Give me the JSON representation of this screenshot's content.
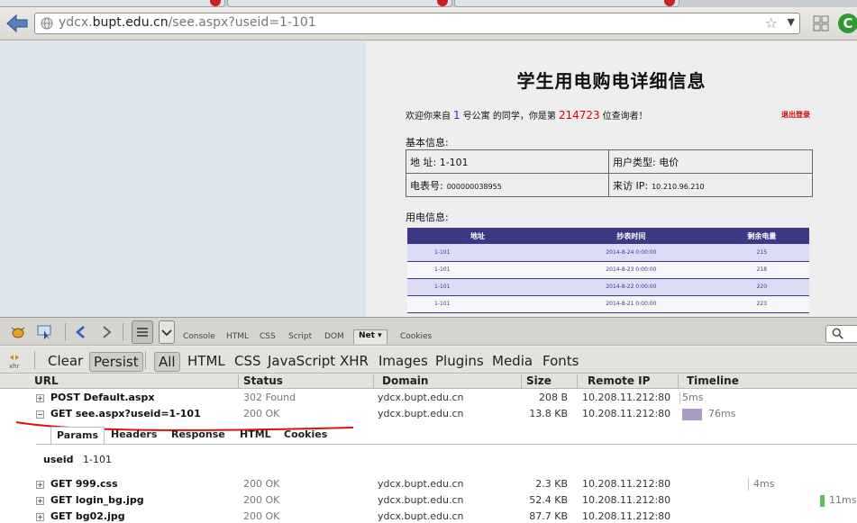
{
  "browser": {
    "url_prefix": "ydcx.",
    "url_host": "bupt.edu.cn",
    "url_path": "/see.aspx?useid=1-101"
  },
  "page": {
    "title": "学生用电购电详细信息",
    "welcome_a": "欢迎你来自",
    "dorm_no": "1",
    "welcome_b": "号公寓",
    "welcome_c": "的同学，你是第",
    "visitor_count": "214723",
    "welcome_d": "位查询者！",
    "logout": "退出登录",
    "basic_label": "基本信息:",
    "info": {
      "address_label": "地 址:",
      "address": "1-101",
      "user_type_label": "用户类型:",
      "user_type": "电价",
      "meter_label": "电表号:",
      "meter": "000000038955",
      "ip_label": "来访 IP:",
      "ip": "10.210.96.210"
    },
    "usage_label": "用电信息:",
    "usage_table": {
      "headers": [
        "地址",
        "抄表时间",
        "剩余电量"
      ],
      "rows": [
        [
          "1-101",
          "2014-8-24 0:00:00",
          "215"
        ],
        [
          "1-101",
          "2014-8-23 0:00:00",
          "218"
        ],
        [
          "1-101",
          "2014-8-22 0:00:00",
          "220"
        ],
        [
          "1-101",
          "2014-8-21 0:00:00",
          "223"
        ]
      ]
    }
  },
  "firebug": {
    "panel_tabs": [
      "Console",
      "HTML",
      "CSS",
      "Script",
      "DOM",
      "Net ▾",
      "Cookies"
    ],
    "filters": [
      "Clear",
      "Persist",
      "All",
      "HTML",
      "CSS",
      "JavaScript",
      "XHR",
      "Images",
      "Plugins",
      "Media",
      "Fonts"
    ],
    "xhr_icon_label": "xhr",
    "columns": [
      "URL",
      "Status",
      "Domain",
      "Size",
      "Remote IP",
      "Timeline"
    ],
    "requests": [
      {
        "url": "POST Default.aspx",
        "status": "302 Found",
        "domain": "ydcx.bupt.edu.cn",
        "size": "208 B",
        "ip": "10.208.11.212:80",
        "time": "5ms"
      },
      {
        "url": "GET see.aspx?useid=1-101",
        "status": "200 OK",
        "domain": "ydcx.bupt.edu.cn",
        "size": "13.8 KB",
        "ip": "10.208.11.212:80",
        "time": "76ms"
      },
      {
        "url": "GET 999.css",
        "status": "200 OK",
        "domain": "ydcx.bupt.edu.cn",
        "size": "2.3 KB",
        "ip": "10.208.11.212:80",
        "time": "4ms"
      },
      {
        "url": "GET login_bg.jpg",
        "status": "200 OK",
        "domain": "ydcx.bupt.edu.cn",
        "size": "52.4 KB",
        "ip": "10.208.11.212:80",
        "time": "11ms"
      },
      {
        "url": "GET bg02.jpg",
        "status": "200 OK",
        "domain": "ydcx.bupt.edu.cn",
        "size": "87.7 KB",
        "ip": "10.208.11.212:80",
        "time": ""
      }
    ],
    "detail_tabs": [
      "Params",
      "Headers",
      "Response",
      "HTML",
      "Cookies"
    ],
    "param_key": "useid",
    "param_value": "1-101"
  }
}
